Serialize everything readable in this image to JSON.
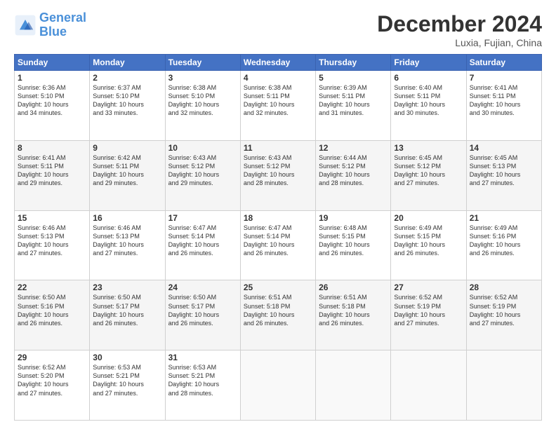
{
  "logo": {
    "line1": "General",
    "line2": "Blue"
  },
  "title": "December 2024",
  "subtitle": "Luxia, Fujian, China",
  "days_of_week": [
    "Sunday",
    "Monday",
    "Tuesday",
    "Wednesday",
    "Thursday",
    "Friday",
    "Saturday"
  ],
  "weeks": [
    [
      {
        "day": 1,
        "lines": [
          "Sunrise: 6:36 AM",
          "Sunset: 5:10 PM",
          "Daylight: 10 hours",
          "and 34 minutes."
        ]
      },
      {
        "day": 2,
        "lines": [
          "Sunrise: 6:37 AM",
          "Sunset: 5:10 PM",
          "Daylight: 10 hours",
          "and 33 minutes."
        ]
      },
      {
        "day": 3,
        "lines": [
          "Sunrise: 6:38 AM",
          "Sunset: 5:10 PM",
          "Daylight: 10 hours",
          "and 32 minutes."
        ]
      },
      {
        "day": 4,
        "lines": [
          "Sunrise: 6:38 AM",
          "Sunset: 5:11 PM",
          "Daylight: 10 hours",
          "and 32 minutes."
        ]
      },
      {
        "day": 5,
        "lines": [
          "Sunrise: 6:39 AM",
          "Sunset: 5:11 PM",
          "Daylight: 10 hours",
          "and 31 minutes."
        ]
      },
      {
        "day": 6,
        "lines": [
          "Sunrise: 6:40 AM",
          "Sunset: 5:11 PM",
          "Daylight: 10 hours",
          "and 30 minutes."
        ]
      },
      {
        "day": 7,
        "lines": [
          "Sunrise: 6:41 AM",
          "Sunset: 5:11 PM",
          "Daylight: 10 hours",
          "and 30 minutes."
        ]
      }
    ],
    [
      {
        "day": 8,
        "lines": [
          "Sunrise: 6:41 AM",
          "Sunset: 5:11 PM",
          "Daylight: 10 hours",
          "and 29 minutes."
        ]
      },
      {
        "day": 9,
        "lines": [
          "Sunrise: 6:42 AM",
          "Sunset: 5:11 PM",
          "Daylight: 10 hours",
          "and 29 minutes."
        ]
      },
      {
        "day": 10,
        "lines": [
          "Sunrise: 6:43 AM",
          "Sunset: 5:12 PM",
          "Daylight: 10 hours",
          "and 29 minutes."
        ]
      },
      {
        "day": 11,
        "lines": [
          "Sunrise: 6:43 AM",
          "Sunset: 5:12 PM",
          "Daylight: 10 hours",
          "and 28 minutes."
        ]
      },
      {
        "day": 12,
        "lines": [
          "Sunrise: 6:44 AM",
          "Sunset: 5:12 PM",
          "Daylight: 10 hours",
          "and 28 minutes."
        ]
      },
      {
        "day": 13,
        "lines": [
          "Sunrise: 6:45 AM",
          "Sunset: 5:12 PM",
          "Daylight: 10 hours",
          "and 27 minutes."
        ]
      },
      {
        "day": 14,
        "lines": [
          "Sunrise: 6:45 AM",
          "Sunset: 5:13 PM",
          "Daylight: 10 hours",
          "and 27 minutes."
        ]
      }
    ],
    [
      {
        "day": 15,
        "lines": [
          "Sunrise: 6:46 AM",
          "Sunset: 5:13 PM",
          "Daylight: 10 hours",
          "and 27 minutes."
        ]
      },
      {
        "day": 16,
        "lines": [
          "Sunrise: 6:46 AM",
          "Sunset: 5:13 PM",
          "Daylight: 10 hours",
          "and 27 minutes."
        ]
      },
      {
        "day": 17,
        "lines": [
          "Sunrise: 6:47 AM",
          "Sunset: 5:14 PM",
          "Daylight: 10 hours",
          "and 26 minutes."
        ]
      },
      {
        "day": 18,
        "lines": [
          "Sunrise: 6:47 AM",
          "Sunset: 5:14 PM",
          "Daylight: 10 hours",
          "and 26 minutes."
        ]
      },
      {
        "day": 19,
        "lines": [
          "Sunrise: 6:48 AM",
          "Sunset: 5:15 PM",
          "Daylight: 10 hours",
          "and 26 minutes."
        ]
      },
      {
        "day": 20,
        "lines": [
          "Sunrise: 6:49 AM",
          "Sunset: 5:15 PM",
          "Daylight: 10 hours",
          "and 26 minutes."
        ]
      },
      {
        "day": 21,
        "lines": [
          "Sunrise: 6:49 AM",
          "Sunset: 5:16 PM",
          "Daylight: 10 hours",
          "and 26 minutes."
        ]
      }
    ],
    [
      {
        "day": 22,
        "lines": [
          "Sunrise: 6:50 AM",
          "Sunset: 5:16 PM",
          "Daylight: 10 hours",
          "and 26 minutes."
        ]
      },
      {
        "day": 23,
        "lines": [
          "Sunrise: 6:50 AM",
          "Sunset: 5:17 PM",
          "Daylight: 10 hours",
          "and 26 minutes."
        ]
      },
      {
        "day": 24,
        "lines": [
          "Sunrise: 6:50 AM",
          "Sunset: 5:17 PM",
          "Daylight: 10 hours",
          "and 26 minutes."
        ]
      },
      {
        "day": 25,
        "lines": [
          "Sunrise: 6:51 AM",
          "Sunset: 5:18 PM",
          "Daylight: 10 hours",
          "and 26 minutes."
        ]
      },
      {
        "day": 26,
        "lines": [
          "Sunrise: 6:51 AM",
          "Sunset: 5:18 PM",
          "Daylight: 10 hours",
          "and 26 minutes."
        ]
      },
      {
        "day": 27,
        "lines": [
          "Sunrise: 6:52 AM",
          "Sunset: 5:19 PM",
          "Daylight: 10 hours",
          "and 27 minutes."
        ]
      },
      {
        "day": 28,
        "lines": [
          "Sunrise: 6:52 AM",
          "Sunset: 5:19 PM",
          "Daylight: 10 hours",
          "and 27 minutes."
        ]
      }
    ],
    [
      {
        "day": 29,
        "lines": [
          "Sunrise: 6:52 AM",
          "Sunset: 5:20 PM",
          "Daylight: 10 hours",
          "and 27 minutes."
        ]
      },
      {
        "day": 30,
        "lines": [
          "Sunrise: 6:53 AM",
          "Sunset: 5:21 PM",
          "Daylight: 10 hours",
          "and 27 minutes."
        ]
      },
      {
        "day": 31,
        "lines": [
          "Sunrise: 6:53 AM",
          "Sunset: 5:21 PM",
          "Daylight: 10 hours",
          "and 28 minutes."
        ]
      },
      null,
      null,
      null,
      null
    ]
  ]
}
